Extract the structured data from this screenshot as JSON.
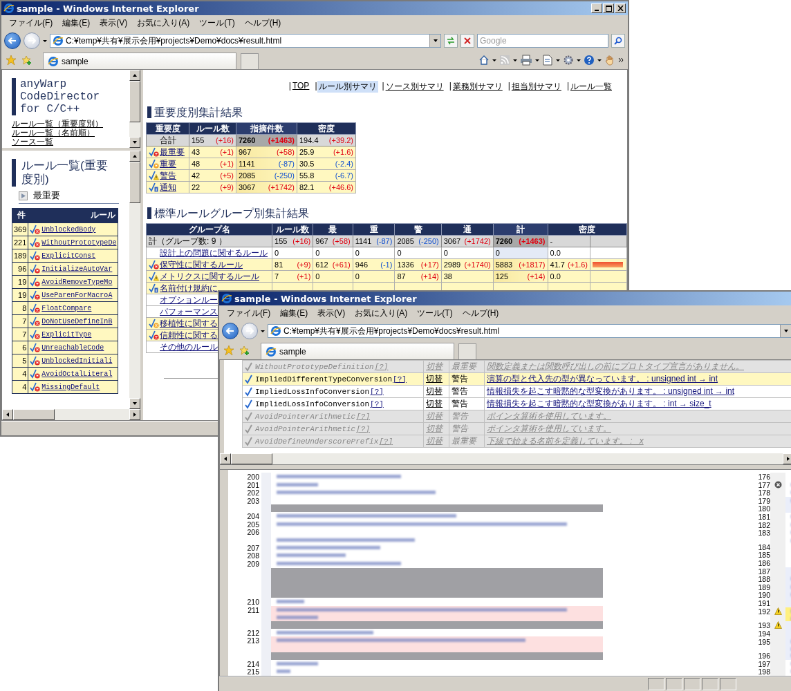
{
  "main_window": {
    "title": "sample - Windows Internet Explorer",
    "menu": [
      "ファイル(F)",
      "編集(E)",
      "表示(V)",
      "お気に入り(A)",
      "ツール(T)",
      "ヘルプ(H)"
    ],
    "address": "C:¥temp¥共有¥展示会用¥projects¥Demo¥docs¥result.html",
    "search": {
      "placeholder": "Google"
    },
    "tab": "sample"
  },
  "nav_frame": {
    "product": "anyWarp CodeDirector for C/C++",
    "links": [
      "ルール一覧（重要度別）",
      "ルール一覧（名前順）",
      "ソース一覧"
    ]
  },
  "rule_frame": {
    "heading": "ルール一覧(重要度別)",
    "group": "最重要",
    "columns": [
      "件",
      "ルール"
    ],
    "rows": [
      {
        "count": "369",
        "name": "UnblockedBody",
        "kind": "critical"
      },
      {
        "count": "221",
        "name": "WithoutPrototypeDe",
        "kind": "critical"
      },
      {
        "count": "189",
        "name": "ExplicitConst",
        "kind": "critical"
      },
      {
        "count": "96",
        "name": "InitializeAutoVar",
        "kind": "critical"
      },
      {
        "count": "19",
        "name": "AvoidRemoveTypeMo",
        "kind": "critical"
      },
      {
        "count": "19",
        "name": "UseParenForMacroA",
        "kind": "critical"
      },
      {
        "count": "8",
        "name": "FloatCompare",
        "kind": "critical"
      },
      {
        "count": "7",
        "name": "DoNotUseDefineInB",
        "kind": "critical"
      },
      {
        "count": "7",
        "name": "ExplicitType",
        "kind": "critical"
      },
      {
        "count": "6",
        "name": "UnreachableCode",
        "kind": "critical"
      },
      {
        "count": "5",
        "name": "UnblockedInitiali",
        "kind": "critical"
      },
      {
        "count": "4",
        "name": "AvoidOctalLiteral",
        "kind": "critical"
      },
      {
        "count": "4",
        "name": "MissingDefault",
        "kind": "critical"
      }
    ]
  },
  "nav": {
    "separator": "|",
    "items": [
      {
        "label": "TOP",
        "selected": false
      },
      {
        "label": "ルール別サマリ",
        "selected": true
      },
      {
        "label": "ソース別サマリ",
        "selected": false
      },
      {
        "label": "業務別サマリ",
        "selected": false
      },
      {
        "label": "担当別サマリ",
        "selected": false
      },
      {
        "label": "ルール一覧",
        "selected": false
      }
    ]
  },
  "severity_summary": {
    "title": "重要度別集計結果",
    "columns": [
      {
        "label": "重要度",
        "sorted": false
      },
      {
        "label": "ルール数",
        "sorted": false
      },
      {
        "label": "指摘件数",
        "sorted": true
      },
      {
        "label": "密度",
        "sorted": false
      }
    ],
    "total": {
      "cells": [
        {
          "value": "合計"
        },
        {
          "value": "155",
          "delta": "(+16)",
          "up": true
        },
        {
          "value": "7260",
          "delta": "(+1463)",
          "up": true
        },
        {
          "value": "194.4",
          "delta": "(+39.2)",
          "up": true
        }
      ]
    },
    "rows": [
      {
        "kind": "critical",
        "cells": [
          {
            "value": "最重要"
          },
          {
            "value": "43",
            "delta": "(+1)",
            "up": true
          },
          {
            "value": "967",
            "delta": "(+58)",
            "up": true
          },
          {
            "value": "25.9",
            "delta": "(+1.6)",
            "up": true
          }
        ]
      },
      {
        "kind": "major",
        "cells": [
          {
            "value": "重要"
          },
          {
            "value": "48",
            "delta": "(+1)",
            "up": true
          },
          {
            "value": "1141",
            "delta": "(-87)",
            "up": false
          },
          {
            "value": "30.5",
            "delta": "(-2.4)",
            "up": false
          }
        ]
      },
      {
        "kind": "warning",
        "cells": [
          {
            "value": "警告"
          },
          {
            "value": "42",
            "delta": "(+5)",
            "up": true
          },
          {
            "value": "2085",
            "delta": "(-250)",
            "up": false
          },
          {
            "value": "55.8",
            "delta": "(-6.7)",
            "up": false
          }
        ]
      },
      {
        "kind": "info",
        "cells": [
          {
            "value": "通知"
          },
          {
            "value": "22",
            "delta": "(+9)",
            "up": true
          },
          {
            "value": "3067",
            "delta": "(+1742)",
            "up": true
          },
          {
            "value": "82.1",
            "delta": "(+46.6)",
            "up": true
          }
        ]
      }
    ]
  },
  "group_summary": {
    "title": "標準ルールグループ別集計結果",
    "columns": [
      {
        "label": "グループ名",
        "sorted": false
      },
      {
        "label": "ルール数",
        "sorted": false
      },
      {
        "label": "最",
        "sorted": false
      },
      {
        "label": "重",
        "sorted": false
      },
      {
        "label": "警",
        "sorted": false
      },
      {
        "label": "通",
        "sorted": false
      },
      {
        "label": "計",
        "sorted": true
      },
      {
        "label": "密度",
        "sorted": false
      }
    ],
    "total": {
      "cells": [
        {
          "value": "計（グループ数: 9 ）"
        },
        {
          "value": "155",
          "delta": "(+16)",
          "up": true
        },
        {
          "value": "967",
          "delta": "(+58)",
          "up": true
        },
        {
          "value": "1141",
          "delta": "(-87)",
          "up": false
        },
        {
          "value": "2085",
          "delta": "(-250)",
          "up": false
        },
        {
          "value": "3067",
          "delta": "(+1742)",
          "up": true
        },
        {
          "value": "7260",
          "delta": "(+1463)",
          "up": true
        },
        {
          "value": "-"
        }
      ]
    },
    "rows": [
      {
        "kind": "none",
        "cells": [
          {
            "value": "設計上の問題に関するルール"
          },
          {
            "value": "0"
          },
          {
            "value": "0"
          },
          {
            "value": "0"
          },
          {
            "value": "0"
          },
          {
            "value": "0"
          },
          {
            "value": "0"
          },
          {
            "value": "0.0"
          }
        ]
      },
      {
        "kind": "critical",
        "level": 0.95,
        "cells": [
          {
            "value": "保守性に関するルール"
          },
          {
            "value": "81",
            "delta": "(+9)",
            "up": true
          },
          {
            "value": "612",
            "delta": "(+61)",
            "up": true
          },
          {
            "value": "946",
            "delta": "(-1)",
            "up": false
          },
          {
            "value": "1336",
            "delta": "(+17)",
            "up": true
          },
          {
            "value": "2989",
            "delta": "(+1740)",
            "up": true
          },
          {
            "value": "5883",
            "delta": "(+1817)",
            "up": true
          },
          {
            "value": "41.7",
            "delta": "(+1.6)",
            "up": true
          }
        ]
      },
      {
        "kind": "warning",
        "cells": [
          {
            "value": "メトリクスに関するルール"
          },
          {
            "value": "7",
            "delta": "(+1)",
            "up": true
          },
          {
            "value": "0"
          },
          {
            "value": "0"
          },
          {
            "value": "87",
            "delta": "(+14)",
            "up": true
          },
          {
            "value": "38"
          },
          {
            "value": "125",
            "delta": "(+14)",
            "up": true
          },
          {
            "value": "0.0"
          }
        ]
      },
      {
        "kind": "info",
        "cells": [
          {
            "value": "名前付け規約に"
          }
        ]
      },
      {
        "kind": "none",
        "cells": [
          {
            "value": "オプションルー"
          }
        ]
      },
      {
        "kind": "none",
        "cells": [
          {
            "value": "パフォーマンス"
          }
        ]
      },
      {
        "kind": "major",
        "cells": [
          {
            "value": "移植性に関する"
          }
        ]
      },
      {
        "kind": "critical",
        "cells": [
          {
            "value": "信頼性に関する"
          }
        ]
      },
      {
        "kind": "none",
        "cells": [
          {
            "value": "その他のルール"
          }
        ]
      }
    ]
  },
  "detail_window": {
    "title": "sample - Windows Internet Explorer",
    "menu": [
      "ファイル(F)",
      "編集(E)",
      "表示(V)",
      "お気に入り(A)",
      "ツール(T)",
      "ヘルプ(H)"
    ],
    "address": "C:¥temp¥共有¥展示会用¥projects¥Demo¥docs¥result.html",
    "tab": "sample",
    "violations": [
      {
        "rule": "WithoutPrototypeDefinition",
        "help": "[?]",
        "action": "切替",
        "severity": "最重要",
        "message": "関数定義または関数呼び出しの前にプロトタイプ宣言がありません。",
        "disabled": true,
        "selected": false
      },
      {
        "rule": "ImpliedDifferentTypeConversion",
        "help": "[?]",
        "action": "切替",
        "severity": "警告",
        "message": "演算の型と代入先の型が異なっています。 : unsigned int → int",
        "disabled": false,
        "selected": true
      },
      {
        "rule": "ImpliedLossInfoConversion",
        "help": "[?]",
        "action": "切替",
        "severity": "警告",
        "message": "情報損失を起こす暗黙的な型変換があります。 : unsigned int → int",
        "disabled": false,
        "selected": false
      },
      {
        "rule": "ImpliedLossInfoConversion",
        "help": "[?]",
        "action": "切替",
        "severity": "警告",
        "message": "情報損失を起こす暗黙的な型変換があります。 : int → size_t",
        "disabled": false,
        "selected": false
      },
      {
        "rule": "AvoidPointerArithmetic",
        "help": "[?]",
        "action": "切替",
        "severity": "警告",
        "message": "ポインタ算術を使用しています。",
        "disabled": true,
        "selected": false
      },
      {
        "rule": "AvoidPointerArithmetic",
        "help": "[?]",
        "action": "切替",
        "severity": "警告",
        "message": "ポインタ算術を使用しています。",
        "disabled": true,
        "selected": false
      },
      {
        "rule": "AvoidDefineUnderscorePrefix",
        "help": "[?]",
        "action": "切替",
        "severity": "最重要",
        "message": "下線で始まる名前を定義しています。 : _x",
        "disabled": true,
        "selected": false
      }
    ],
    "diff": {
      "left": [
        {
          "number": "200",
          "kind": "plain"
        },
        {
          "number": "201",
          "kind": "plain"
        },
        {
          "number": "202",
          "kind": "plain"
        },
        {
          "number": "203",
          "kind": "plain"
        },
        {
          "kind": "gap"
        },
        {
          "number": "204",
          "kind": "plain"
        },
        {
          "number": "205",
          "kind": "plain"
        },
        {
          "number": "206",
          "kind": "plain"
        },
        {
          "kind": "plain"
        },
        {
          "number": "207",
          "kind": "plain"
        },
        {
          "number": "208",
          "kind": "plain"
        },
        {
          "number": "209",
          "kind": "plain"
        },
        {
          "kind": "gap"
        },
        {
          "kind": "gap"
        },
        {
          "kind": "gap"
        },
        {
          "kind": "gap"
        },
        {
          "number": "210",
          "kind": "plain"
        },
        {
          "number": "211",
          "kind": "deleted"
        },
        {
          "kind": "deleted"
        },
        {
          "kind": "gap"
        },
        {
          "number": "212",
          "kind": "plain"
        },
        {
          "number": "213",
          "kind": "deleted"
        },
        {
          "kind": "deleted"
        },
        {
          "kind": "gap"
        },
        {
          "number": "214",
          "kind": "plain"
        },
        {
          "number": "215",
          "kind": "plain"
        }
      ],
      "right": [
        {
          "number": "176",
          "kind": "plain"
        },
        {
          "number": "177",
          "kind": "plain",
          "marker": {
            "kind": "error"
          }
        },
        {
          "number": "178",
          "kind": "plain"
        },
        {
          "number": "179",
          "kind": "added"
        },
        {
          "number": "180",
          "kind": "added"
        },
        {
          "number": "181",
          "kind": "plain"
        },
        {
          "number": "182",
          "kind": "plain"
        },
        {
          "number": "183",
          "kind": "plain"
        },
        {
          "kind": "plain"
        },
        {
          "number": "184",
          "kind": "plain"
        },
        {
          "number": "185",
          "kind": "plain"
        },
        {
          "number": "186",
          "kind": "plain"
        },
        {
          "number": "187",
          "kind": "added"
        },
        {
          "number": "188",
          "kind": "added"
        },
        {
          "number": "189",
          "kind": "added"
        },
        {
          "number": "190",
          "kind": "added"
        },
        {
          "number": "191",
          "kind": "added"
        },
        {
          "number": "192",
          "kind": "changed",
          "marker": {
            "kind": "warning"
          }
        },
        {
          "kind": "changed"
        },
        {
          "number": "193",
          "kind": "added",
          "marker": {
            "kind": "warning"
          }
        },
        {
          "number": "194",
          "kind": "added"
        },
        {
          "number": "195",
          "kind": "added"
        },
        {
          "kind": "added"
        },
        {
          "number": "196",
          "kind": "added"
        },
        {
          "number": "197",
          "kind": "plain"
        },
        {
          "number": "198",
          "kind": "plain"
        }
      ]
    }
  }
}
